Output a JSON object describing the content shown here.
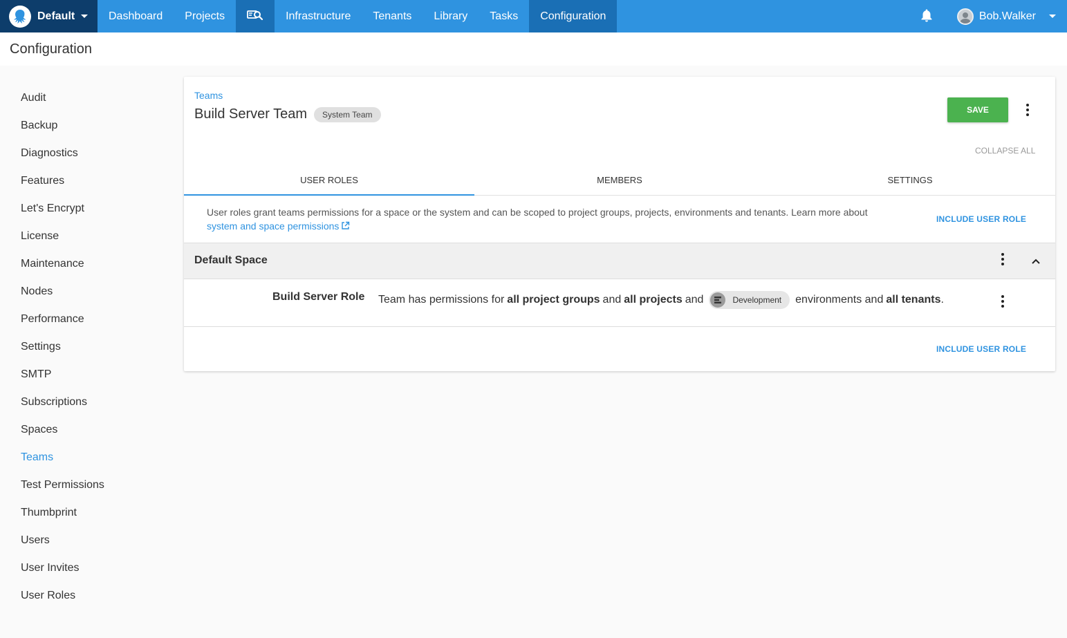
{
  "nav": {
    "space_name": "Default",
    "items": [
      "Dashboard",
      "Projects",
      "Infrastructure",
      "Tenants",
      "Library",
      "Tasks",
      "Configuration"
    ],
    "active": "Configuration",
    "user_name": "Bob.Walker",
    "accent_color": "#2f93e0",
    "active_color": "#1a6fb5"
  },
  "page": {
    "title": "Configuration"
  },
  "sidebar": {
    "items": [
      "Audit",
      "Backup",
      "Diagnostics",
      "Features",
      "Let's Encrypt",
      "License",
      "Maintenance",
      "Nodes",
      "Performance",
      "Settings",
      "SMTP",
      "Subscriptions",
      "Spaces",
      "Teams",
      "Test Permissions",
      "Thumbprint",
      "Users",
      "User Invites",
      "User Roles"
    ],
    "active": "Teams"
  },
  "team": {
    "breadcrumb": "Teams",
    "name": "Build Server Team",
    "badge": "System Team",
    "save_label": "SAVE",
    "collapse_all": "COLLAPSE ALL",
    "save_color": "#4bb24f"
  },
  "tabs": [
    {
      "label": "USER ROLES",
      "active": true
    },
    {
      "label": "MEMBERS",
      "active": false
    },
    {
      "label": "SETTINGS",
      "active": false
    }
  ],
  "info": {
    "text": "User roles grant teams permissions for a space or the system and can be scoped to project groups, projects, environments and tenants. Learn more about",
    "link": "system and space permissions"
  },
  "include_role_label": "INCLUDE USER ROLE",
  "space_section": {
    "title": "Default Space",
    "role": {
      "name": "Build Server Role",
      "desc_prefix": "Team has permissions for",
      "bold1": "all project groups",
      "and1": "and",
      "bold2": "all projects",
      "and2": "and",
      "environment": "Development",
      "desc_mid": "environments and",
      "bold3": "all tenants",
      "desc_end": "."
    }
  }
}
